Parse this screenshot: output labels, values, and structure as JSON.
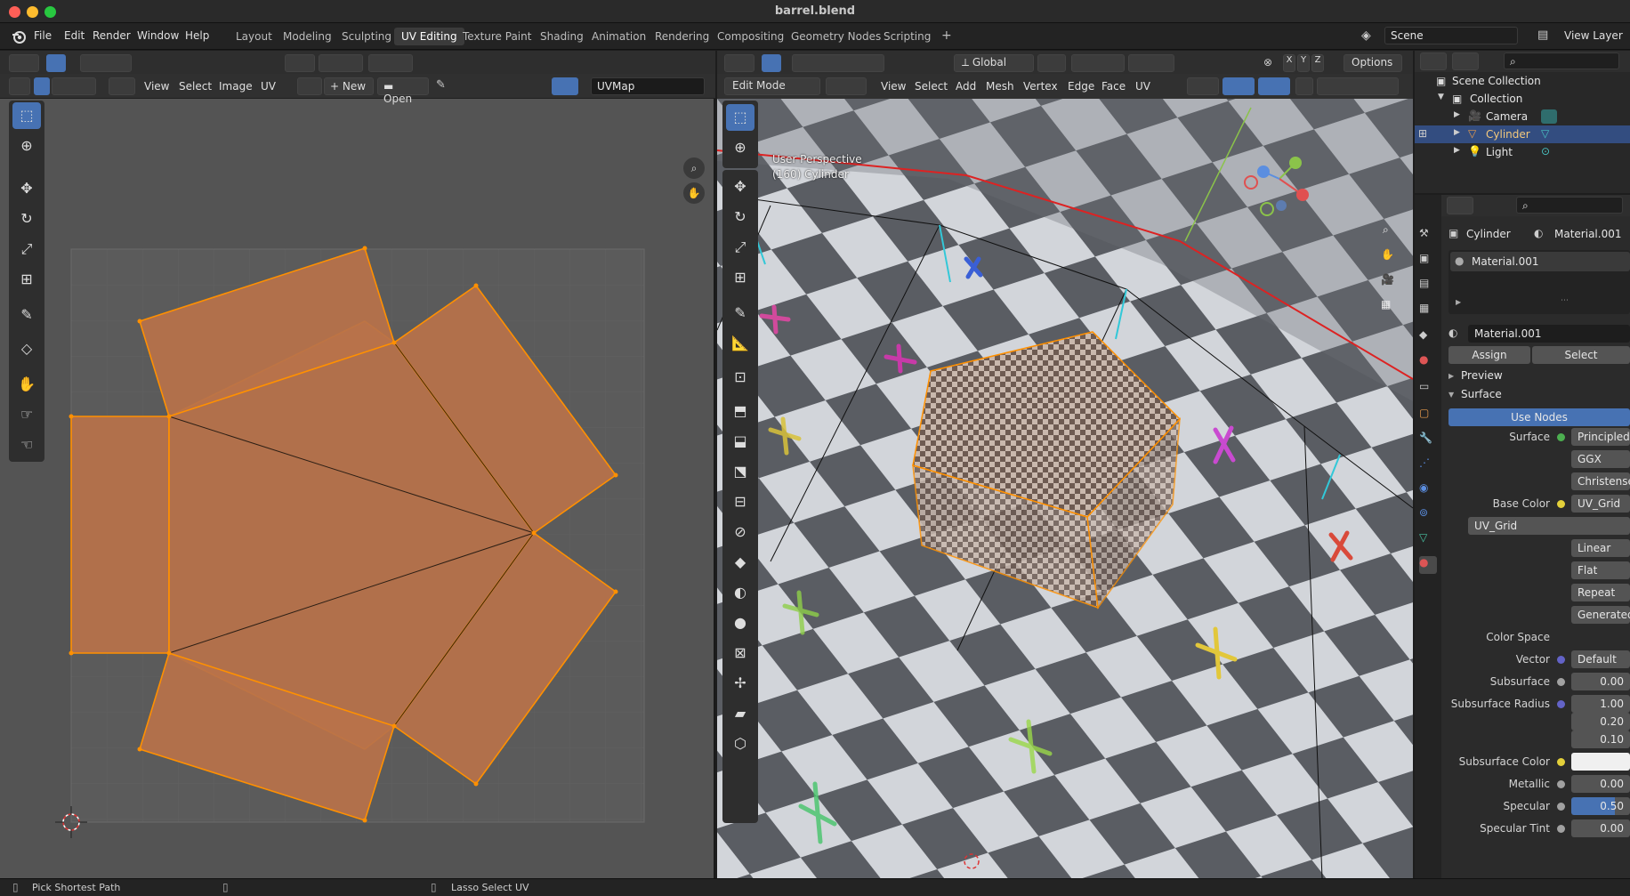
{
  "window": {
    "title": "barrel.blend"
  },
  "menu": [
    "File",
    "Edit",
    "Render",
    "Window",
    "Help"
  ],
  "workspaces": [
    "Layout",
    "Modeling",
    "Sculpting",
    "UV Editing",
    "Texture Paint",
    "Shading",
    "Animation",
    "Rendering",
    "Compositing",
    "Geometry Nodes",
    "Scripting"
  ],
  "active_workspace": "UV Editing",
  "scene": {
    "name": "Scene",
    "view_layer": "View Layer"
  },
  "uv_editor": {
    "menus": [
      "View",
      "Select",
      "Image",
      "UV"
    ],
    "new_label": "New",
    "open_label": "Open",
    "uvmap": "UVMap"
  },
  "viewport": {
    "orientation": "Global",
    "options_label": "Options",
    "mode": "Edit Mode",
    "menus": [
      "View",
      "Select",
      "Add",
      "Mesh",
      "Vertex",
      "Edge",
      "Face",
      "UV"
    ],
    "info_line1": "User Perspective",
    "info_line2": "(160) Cylinder",
    "axis_x": "X",
    "axis_y": "Y",
    "axis_z": "Z"
  },
  "outliner": {
    "root": "Scene Collection",
    "collection": "Collection",
    "items": [
      "Camera",
      "Cylinder",
      "Light"
    ],
    "selected": "Cylinder"
  },
  "properties": {
    "object": "Cylinder",
    "material": "Material.001",
    "slot": "Material.001",
    "material_field": "Material.001",
    "assign": "Assign",
    "select": "Select",
    "preview": "Preview",
    "surface_panel": "Surface",
    "use_nodes": "Use Nodes",
    "rows": [
      {
        "label": "Surface",
        "value": "Principled BSDF"
      },
      {
        "label": "",
        "value": "GGX"
      },
      {
        "label": "",
        "value": "Christensen-Burley"
      },
      {
        "label": "Base Color",
        "value": "UV_Grid"
      },
      {
        "label": "",
        "value": "UV_Grid"
      },
      {
        "label": "",
        "value": "Linear"
      },
      {
        "label": "",
        "value": "Flat"
      },
      {
        "label": "",
        "value": "Repeat"
      },
      {
        "label": "",
        "value": "Generated"
      },
      {
        "label": "Color Space",
        "value": ""
      },
      {
        "label": "Vector",
        "value": "Default"
      },
      {
        "label": "Subsurface",
        "value": "0.00"
      },
      {
        "label": "Subsurface Radius",
        "value": "1.00"
      },
      {
        "label": "",
        "value": "0.20"
      },
      {
        "label": "",
        "value": "0.10"
      },
      {
        "label": "Subsurface Color",
        "value": ""
      },
      {
        "label": "Metallic",
        "value": "0.00"
      },
      {
        "label": "Specular",
        "value": "0.50"
      },
      {
        "label": "Specular Tint",
        "value": "0.00"
      }
    ]
  },
  "status": {
    "left": "Pick Shortest Path",
    "middle": "Lasso Select UV"
  },
  "colors": {
    "accent": "#4772b3",
    "uv_face": "#c07a4e",
    "uv_edge": "#ff8c00",
    "selected_row": "#334d80"
  }
}
